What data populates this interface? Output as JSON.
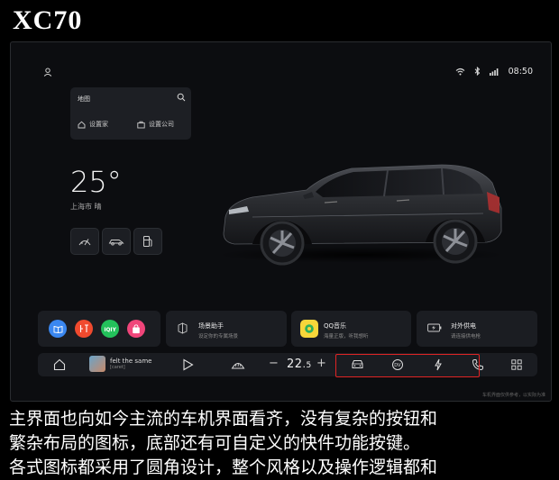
{
  "header": {
    "model": "XC70"
  },
  "status_bar": {
    "time": "08:50"
  },
  "map_card": {
    "title": "地图",
    "home": "设置家",
    "company": "设置公司"
  },
  "weather": {
    "temperature": "25°",
    "location": "上海市 晴"
  },
  "app_cards": {
    "scene": {
      "title": "场景助手",
      "subtitle": "设定你的专属场景"
    },
    "music": {
      "title": "QQ音乐",
      "subtitle": "海量正版，听我想听"
    },
    "power": {
      "title": "对外供电",
      "subtitle": "请连接供电枪"
    }
  },
  "dock": {
    "song_title": "felt the same",
    "song_artist": "[caret]",
    "temperature_value": "22.5",
    "temperature_int": "22",
    "temperature_dec": "5"
  },
  "footnote": "车机界面仅供参考，以实际为准",
  "caption": {
    "line1": "主界面也向如今主流的车机界面看齐，没有复杂的按钮和",
    "line2": "繁杂布局的图标，底部还有可自定义的快件功能按键。",
    "line3": "各式图标都采用了圆角设计，整个风格以及操作逻辑都和"
  },
  "colors": {
    "highlight_box": "#e02424",
    "background": "#0c0d10"
  }
}
